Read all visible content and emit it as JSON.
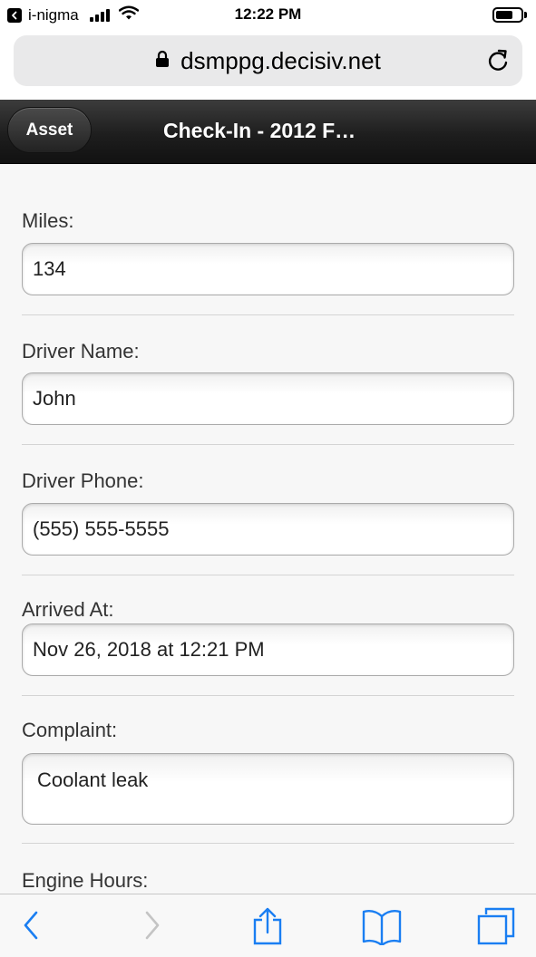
{
  "status_bar": {
    "back_app": "i-nigma",
    "time": "12:22 PM"
  },
  "browser": {
    "url": "dsmppg.decisiv.net"
  },
  "nav": {
    "back_button": "Asset",
    "title": "Check-In - 2012 F…"
  },
  "form": {
    "miles_label": "Miles:",
    "miles_value": "134",
    "driver_name_label": "Driver Name:",
    "driver_name_value": "John",
    "driver_phone_label": "Driver Phone:",
    "driver_phone_value": "(555) 555-5555",
    "arrived_at_label": "Arrived At:",
    "arrived_at_value": "Nov 26, 2018 at 12:21 PM",
    "complaint_label": "Complaint:",
    "complaint_value": "Coolant leak",
    "engine_hours_label": "Engine Hours:"
  },
  "colors": {
    "ios_blue": "#1a7ef2",
    "nav_bar": "#1e1e1e",
    "page_background": "#f7f7f7"
  },
  "icons": {
    "status": [
      "back-arrow-icon",
      "signal-icon",
      "wifi-icon",
      "battery-icon"
    ],
    "browser": [
      "lock-icon",
      "reload-icon"
    ],
    "toolbar": [
      "back-icon",
      "forward-icon",
      "share-icon",
      "bookmarks-icon",
      "tabs-icon"
    ]
  }
}
